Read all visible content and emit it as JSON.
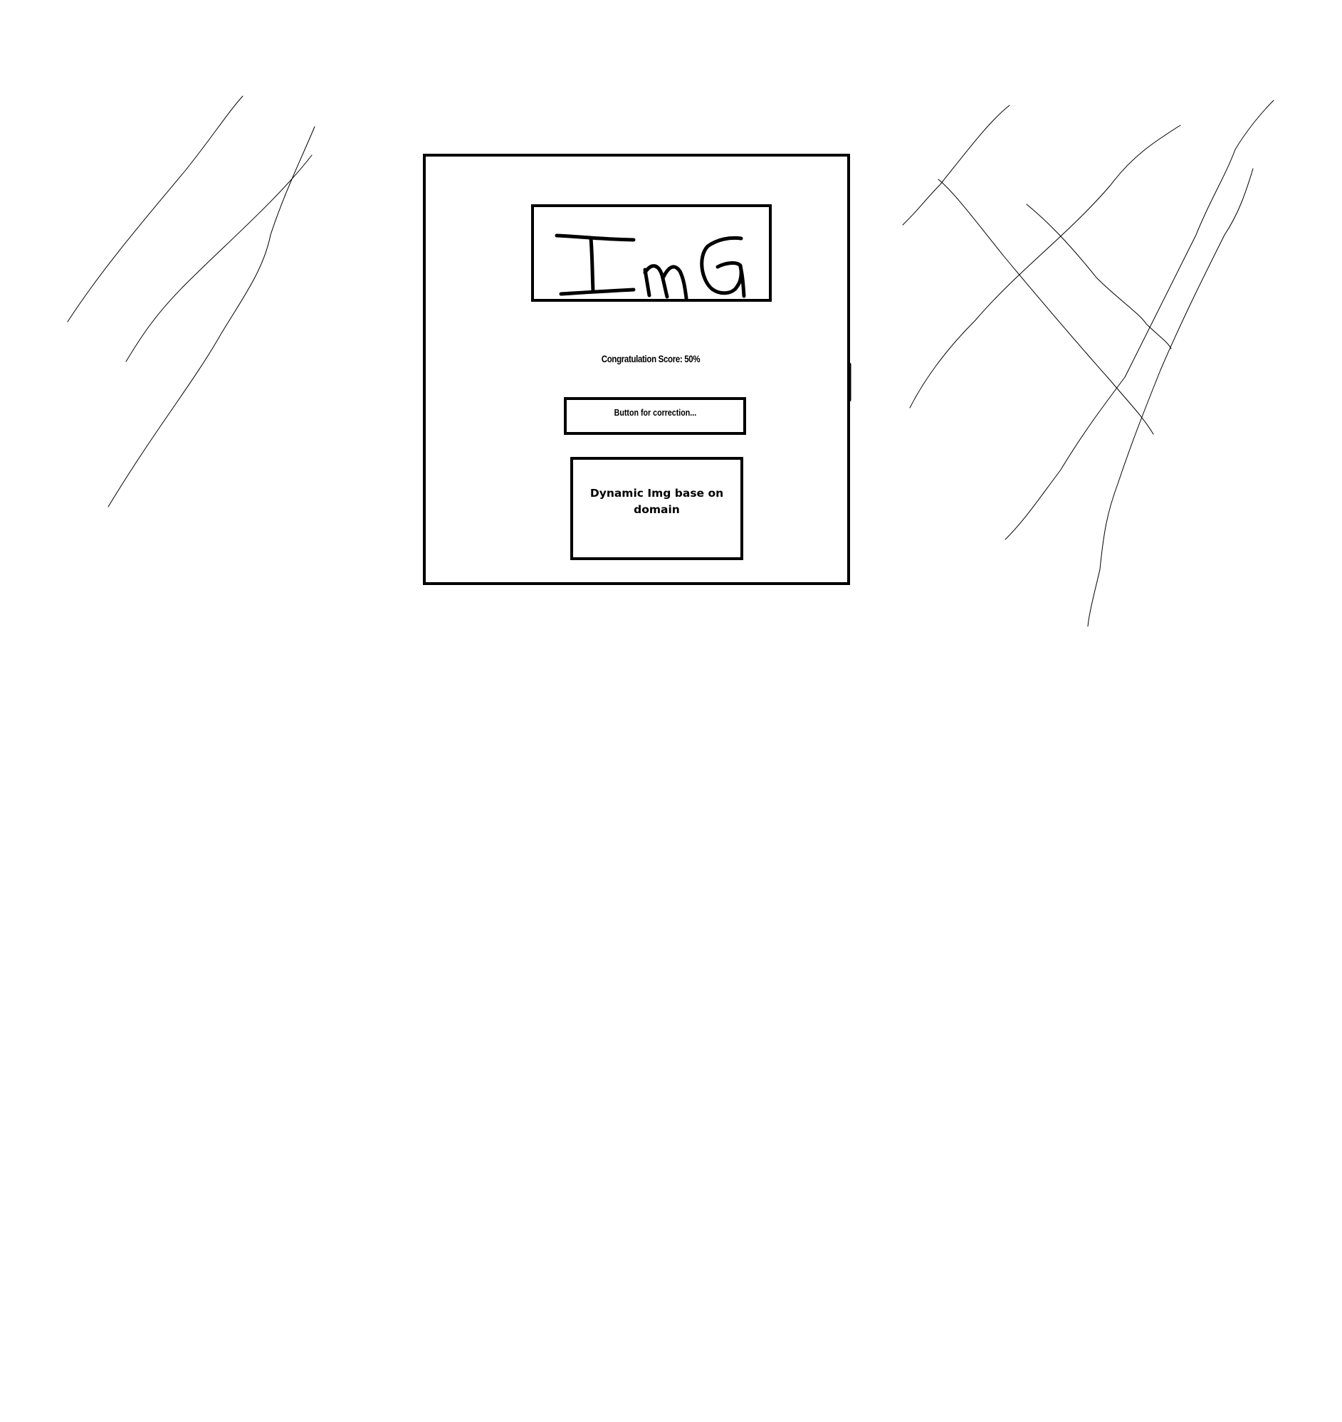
{
  "logo": {
    "text": "ImG"
  },
  "score": {
    "text": "Congratulation Score: 50%"
  },
  "correction_button": {
    "label": "Button for correction..."
  },
  "dynamic_image": {
    "label": "Dynamic Img base on domain"
  },
  "colors": {
    "stroke": "#000000",
    "background": "#ffffff"
  }
}
